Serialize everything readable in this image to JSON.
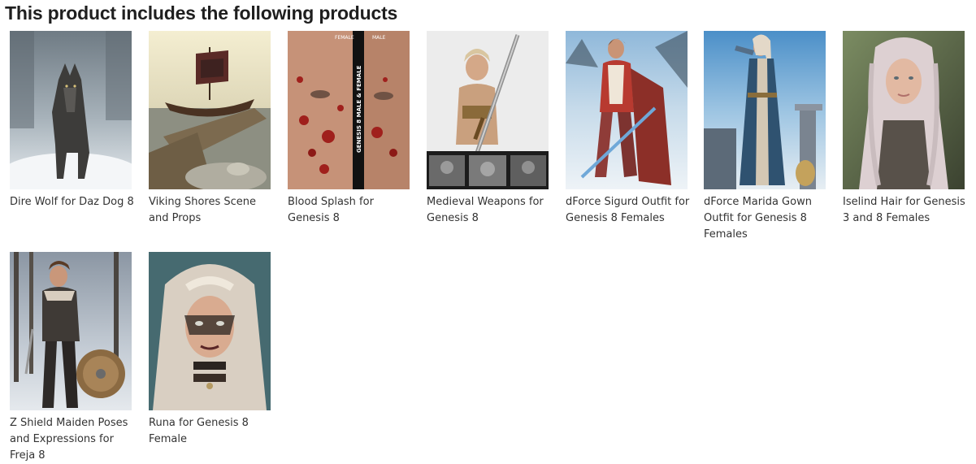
{
  "section": {
    "title": "This product includes the following products"
  },
  "products": [
    {
      "name": "Dire Wolf for Daz Dog 8",
      "image": "wolf-in-snow"
    },
    {
      "name": "Viking Shores Scene and Props",
      "image": "viking-ship-dock"
    },
    {
      "name": "Blood Splash for Genesis 8",
      "image": "blood-splash-face"
    },
    {
      "name": "Medieval Weapons for Genesis 8",
      "image": "warrior-with-sword"
    },
    {
      "name": "dForce Sigurd Outfit for Genesis 8 Females",
      "image": "warrior-woman-snow"
    },
    {
      "name": "dForce Marida Gown Outfit for Genesis 8 Females",
      "image": "woman-in-gown"
    },
    {
      "name": "Iselind Hair for Genesis 3 and 8 Females",
      "image": "woman-long-hair"
    },
    {
      "name": "Z Shield Maiden Poses and Expressions for Freja 8",
      "image": "shield-maiden"
    },
    {
      "name": "Runa for Genesis 8 Female",
      "image": "runa-portrait"
    }
  ],
  "thumbnail_text": {
    "female": "FEMALE",
    "male": "MALE",
    "vertical": "GENESIS 8 MALE & FEMALE"
  }
}
